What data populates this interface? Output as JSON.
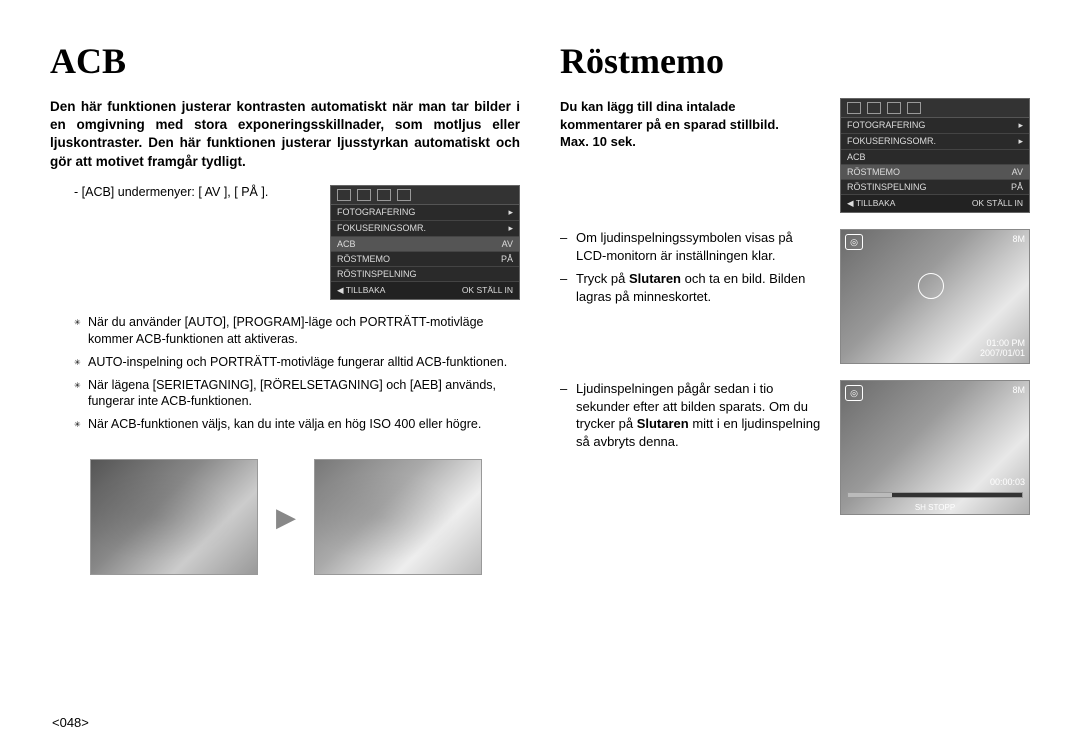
{
  "left": {
    "title": "ACB",
    "intro": "Den här funktionen justerar kontrasten automatiskt när man tar bilder i en omgivning med stora exponeringsskillnader, som motljus eller ljuskontraster. Den här funktionen justerar ljusstyrkan automatiskt och gör att motivet framgår tydligt.",
    "submenu_label": "- [ACB] undermenyer: [ AV ], [ PÅ ].",
    "lcd": {
      "rows": [
        "FOTOGRAFERING",
        "FOKUSERINGSOMR.",
        "ACB",
        "RÖSTMEMO",
        "RÖSTINSPELNING"
      ],
      "vals": [
        "",
        "",
        "AV",
        "PÅ",
        ""
      ],
      "foot_left": "◀  TILLBAKA",
      "foot_right": "OK  STÄLL IN"
    },
    "notes": [
      "När du använder [AUTO], [PROGRAM]-läge och PORTRÄTT-motivläge kommer ACB-funktionen att aktiveras.",
      "AUTO-inspelning och PORTRÄTT-motivläge fungerar alltid ACB-funktionen.",
      "När lägena [SERIETAGNING], [RÖRELSETAGNING] och [AEB] används, fungerar inte ACB-funktionen.",
      "När ACB-funktionen väljs, kan du inte välja en hög ISO 400 eller högre."
    ]
  },
  "right": {
    "title": "Röstmemo",
    "intro_lines": [
      "Du kan lägg till dina intalade",
      "kommentarer på en sparad stillbild.",
      "Max. 10 sek."
    ],
    "lcd": {
      "rows": [
        "FOTOGRAFERING",
        "FOKUSERINGSOMR.",
        "ACB",
        "RÖSTMEMO",
        "RÖSTINSPELNING"
      ],
      "vals": [
        "",
        "",
        "",
        "AV",
        "PÅ"
      ],
      "foot_left": "◀  TILLBAKA",
      "foot_right": "OK  STÄLL IN"
    },
    "bullets1": [
      "Om ljudinspelningssymbolen visas på LCD-monitorn är inställningen klar.",
      "Tryck på Slutaren och ta en bild. Bilden lagras på minneskortet."
    ],
    "bullet1_bold": "Slutaren",
    "bullets2": [
      "Ljudinspelningen pågår sedan i tio sekunder efter att bilden sparats. Om du trycker på Slutaren mitt i en ljudinspelning så avbryts denna."
    ],
    "bullet2_bold": "Slutaren",
    "preview1": {
      "corner": "◎",
      "count": "8M",
      "time": "01:00 PM",
      "date": "2007/01/01"
    },
    "preview2": {
      "corner": "◎",
      "count": "8M",
      "elapsed": "00:00:03",
      "foot": "SH  STOPP"
    }
  },
  "page_number": "<048>"
}
